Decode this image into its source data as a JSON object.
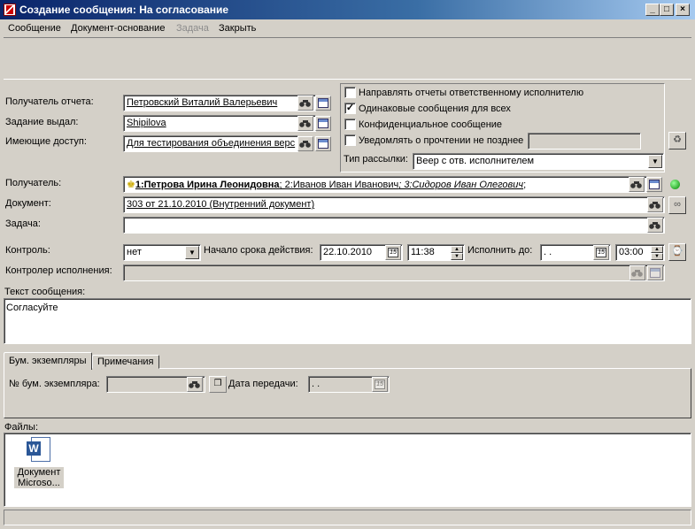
{
  "window": {
    "title": "Создание сообщения: На согласование",
    "min": "_",
    "max": "□",
    "close": "×"
  },
  "menu": [
    "Сообщение",
    "Документ-основание",
    "Задача",
    "Закрыть"
  ],
  "form": {
    "report_recipient_label": "Получатель отчета:",
    "report_recipient_value": "Петровский Виталий Валерьевич",
    "task_issuer_label": "Задание выдал:",
    "task_issuer_value": "Shipilova",
    "access_label": "Имеющие доступ:",
    "access_value": "Для тестирования объединения верс",
    "recipient_label": "Получатель:",
    "recipients": [
      "1:Петрова Ирина Леонидовна",
      "; 2:Иванов Иван Иванович",
      "; 3:Сидоров Иван Олегович",
      ";"
    ],
    "document_label": "Документ:",
    "document_value": "303 от 21.10.2010 (Внутренний документ)",
    "task_label": "Задача:",
    "task_value": "",
    "control_label": "Контроль:",
    "control_value": "нет",
    "start_label": "Начало срока действия:",
    "start_date": "22.10.2010",
    "start_time": "11:38",
    "due_label": "Исполнить до:",
    "due_date": " .  .",
    "due_time": "03:00",
    "controller_label": "Контролер исполнения:",
    "controller_value": "",
    "message_label": "Текст сообщения:",
    "message_text": "Согласуйте"
  },
  "options": {
    "send_reports": {
      "label": "Направлять отчеты ответственному исполнителю",
      "checked": false
    },
    "same_messages": {
      "label": "Одинаковые сообщения для всех",
      "checked": true
    },
    "confidential": {
      "label": "Конфиденциальное сообщение",
      "checked": false
    },
    "notify_read": {
      "label": "Уведомлять о прочтении не позднее",
      "checked": false
    },
    "mailing_type_label": "Тип рассылки:",
    "mailing_type_value": "Веер с отв. исполнителем",
    "check_mark": "✓"
  },
  "tabs": {
    "paper": "Бум. экземпляры",
    "notes": "Примечания"
  },
  "paper": {
    "number_label": "№ бум. экземпляра:",
    "number_value": "",
    "date_label": "Дата передачи:",
    "date_value": " .  ."
  },
  "files": {
    "label": "Файлы:",
    "items": [
      {
        "name_line1": "Документ",
        "name_line2": "Microso...",
        "icon": "word-document-icon"
      }
    ]
  },
  "colors": {
    "title_start": "#0a246a",
    "title_end": "#a6caf0",
    "status_dot": "#008000"
  }
}
